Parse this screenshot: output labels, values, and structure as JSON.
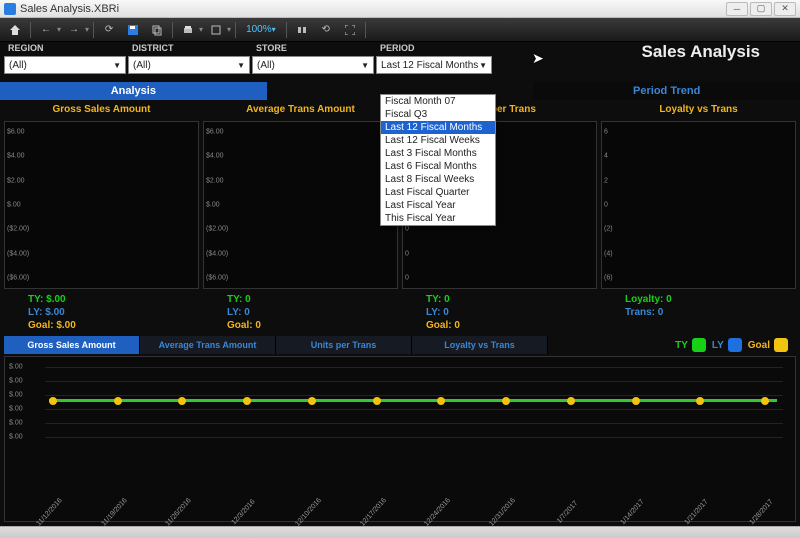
{
  "window_title": "Sales Analysis.XBRi",
  "headline": "Sales Analysis",
  "toolbar": {
    "zoom": "100%"
  },
  "filters": {
    "region": {
      "label": "REGION",
      "value": "(All)"
    },
    "district": {
      "label": "DISTRICT",
      "value": "(All)"
    },
    "store": {
      "label": "STORE",
      "value": "(All)"
    },
    "period": {
      "label": "PERIOD",
      "value": "Last 12 Fiscal Months"
    }
  },
  "period_options": [
    "Fiscal Month 07",
    "Fiscal Q3",
    "Last 12 Fiscal Months",
    "Last 12 Fiscal Weeks",
    "Last 3 Fiscal Months",
    "Last 6 Fiscal Months",
    "Last 8 Fiscal Weeks",
    "Last Fiscal Quarter",
    "Last Fiscal Year",
    "This Fiscal Year"
  ],
  "top_tabs": {
    "analysis": "Analysis",
    "period_trend": "Period Trend"
  },
  "cards": {
    "c0": {
      "title": "Gross Sales Amount",
      "ty_label": "TY:",
      "ty_value": "$.00",
      "ly_label": "LY:",
      "ly_value": "$.00",
      "goal_label": "Goal:",
      "goal_value": "$.00"
    },
    "c1": {
      "title": "Average Trans Amount",
      "ty_label": "TY:",
      "ty_value": "0",
      "ly_label": "LY:",
      "ly_value": "0",
      "goal_label": "Goal:",
      "goal_value": "0"
    },
    "c2": {
      "title": "Units per Trans",
      "ty_label": "TY:",
      "ty_value": "0",
      "ly_label": "LY:",
      "ly_value": "0",
      "goal_label": "Goal:",
      "goal_value": "0"
    },
    "c3": {
      "title": "Loyalty vs Trans",
      "loy_label": "Loyalty:",
      "loy_value": "0",
      "trans_label": "Trans:",
      "trans_value": "0"
    }
  },
  "card_money_ticks": [
    "$6.00",
    "$4.00",
    "$2.00",
    "$.00",
    "($2.00)",
    "($4.00)",
    "($6.00)"
  ],
  "card_zero_ticks": [
    "0",
    "0",
    "0",
    "0",
    "0",
    "0",
    "0"
  ],
  "card_loyalty_ticks": [
    "6",
    "4",
    "2",
    "0",
    "(2)",
    "(4)",
    "(6)"
  ],
  "bottom_tabs": {
    "t0": "Gross Sales Amount",
    "t1": "Average Trans Amount",
    "t2": "Units per Trans",
    "t3": "Loyalty vs Trans"
  },
  "legend": {
    "ty": {
      "label": "TY",
      "color": "#17d117"
    },
    "ly": {
      "label": "LY",
      "color": "#1e6fe0"
    },
    "goal": {
      "label": "Goal",
      "color": "#f2c40f"
    }
  },
  "timeline_yticks": [
    "$.00",
    "$.00",
    "$.00",
    "$.00",
    "$.00",
    "$.00"
  ],
  "timeline_dates": [
    "11/12/2016",
    "11/19/2016",
    "11/26/2016",
    "12/3/2016",
    "12/10/2016",
    "12/17/2016",
    "12/24/2016",
    "12/31/2016",
    "1/7/2017",
    "1/14/2017",
    "1/21/2017",
    "1/28/2017"
  ],
  "colors": {
    "active_blue": "#1e5fbf",
    "link_blue": "#3a87d6",
    "gold": "#f2b51e",
    "green": "#17d117"
  },
  "chart_data": {
    "cards": [
      {
        "title": "Gross Sales Amount",
        "type": "bar",
        "values": [],
        "ylim": [
          -6,
          6
        ],
        "ylabel": "$"
      },
      {
        "title": "Average Trans Amount",
        "type": "bar",
        "values": [],
        "ylim": [
          -6,
          6
        ]
      },
      {
        "title": "Units per Trans",
        "type": "bar",
        "values": [],
        "ylim": null
      },
      {
        "title": "Loyalty vs Trans",
        "type": "bar",
        "values": [],
        "ylim": [
          -6,
          6
        ]
      }
    ],
    "timeline": {
      "type": "line",
      "x": [
        "11/12/2016",
        "11/19/2016",
        "11/26/2016",
        "12/3/2016",
        "12/10/2016",
        "12/17/2016",
        "12/24/2016",
        "12/31/2016",
        "1/7/2017",
        "1/14/2017",
        "1/21/2017",
        "1/28/2017"
      ],
      "series": [
        {
          "name": "TY",
          "values": [
            0,
            0,
            0,
            0,
            0,
            0,
            0,
            0,
            0,
            0,
            0,
            0
          ]
        },
        {
          "name": "LY",
          "values": [
            0,
            0,
            0,
            0,
            0,
            0,
            0,
            0,
            0,
            0,
            0,
            0
          ]
        },
        {
          "name": "Goal",
          "values": [
            0,
            0,
            0,
            0,
            0,
            0,
            0,
            0,
            0,
            0,
            0,
            0
          ]
        }
      ],
      "ylim": [
        0,
        0
      ],
      "ylabel": "$"
    }
  }
}
